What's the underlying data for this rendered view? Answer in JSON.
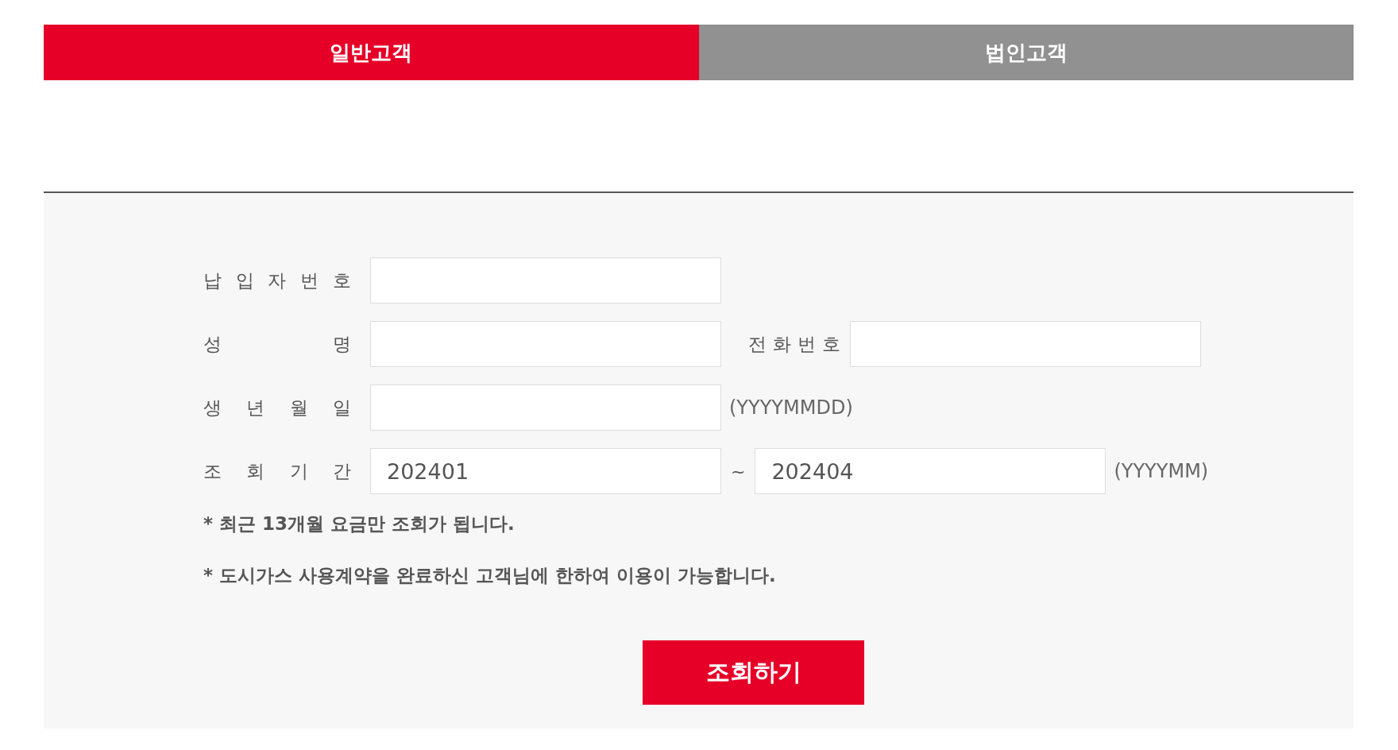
{
  "tabs": [
    {
      "label": "일반고객",
      "selected": true
    },
    {
      "label": "법인고객",
      "selected": false
    }
  ],
  "form": {
    "rows": [
      {
        "fields": [
          {
            "label": "납 입 자 번 호"
          }
        ]
      },
      {
        "fields": [
          {
            "label": "성 명"
          },
          {
            "label": "전 화 번 호"
          }
        ]
      },
      {
        "fields": [
          {
            "label": "생 년 월 일",
            "hint": "(YYYYMMDD)"
          }
        ]
      },
      {
        "fields": [
          {
            "label": "조 회 기 간",
            "value": "202401"
          },
          {
            "separator": "~",
            "value": "202404",
            "hint": "(YYYYMM)"
          }
        ]
      }
    ],
    "notes": [
      "* 최근 13개월 요금만 조회가 됩니다.",
      "* 도시가스 사용계약을 완료하신 고객님에 한하여 이용이 가능합니다."
    ],
    "submit": "조회하기"
  }
}
